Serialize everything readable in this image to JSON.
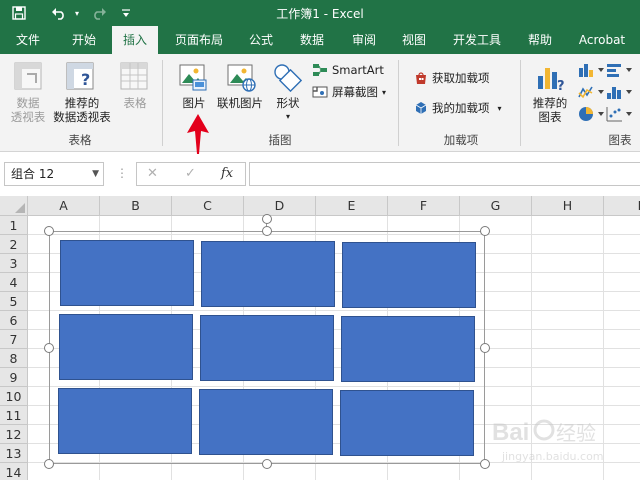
{
  "window": {
    "title": "工作簿1  -  Excel"
  },
  "quick_access": {
    "save_icon": "save-icon",
    "undo_icon": "undo-icon",
    "redo_icon": "redo-icon",
    "customize_icon": "customize-qat-icon"
  },
  "tabs": [
    {
      "label": "文件"
    },
    {
      "label": "开始"
    },
    {
      "label": "插入",
      "active": true
    },
    {
      "label": "页面布局"
    },
    {
      "label": "公式"
    },
    {
      "label": "数据"
    },
    {
      "label": "审阅"
    },
    {
      "label": "视图"
    },
    {
      "label": "开发工具"
    },
    {
      "label": "帮助"
    },
    {
      "label": "Acrobat"
    }
  ],
  "ribbon": {
    "tables": {
      "pivot": "数据\n透视表",
      "rec_pivot": "推荐的\n数据透视表",
      "table": "表格",
      "group": "表格"
    },
    "illustrations": {
      "pictures": "图片",
      "online_pictures": "联机图片",
      "shapes": "形状",
      "smartart": "SmartArt",
      "screenshot": "屏幕截图",
      "group": "插图"
    },
    "addins": {
      "get": "获取加载项",
      "my": "我的加载项",
      "group": "加载项"
    },
    "charts": {
      "recommended": "推荐的\n图表",
      "group": "图表"
    }
  },
  "formula_bar": {
    "name_box": "组合 12",
    "cancel": "✕",
    "enter": "✓",
    "fx": "fx",
    "value": ""
  },
  "columns": [
    "A",
    "B",
    "C",
    "D",
    "E",
    "F",
    "G",
    "H",
    "I"
  ],
  "rows": [
    "1",
    "2",
    "3",
    "4",
    "5",
    "6",
    "7",
    "8",
    "9",
    "10",
    "11",
    "12",
    "13",
    "14"
  ],
  "annotation": {
    "arrow_color": "#e3001b"
  },
  "colors": {
    "excel_green": "#217346",
    "shape_fill": "#4472c4",
    "shape_border": "#2f528f"
  }
}
